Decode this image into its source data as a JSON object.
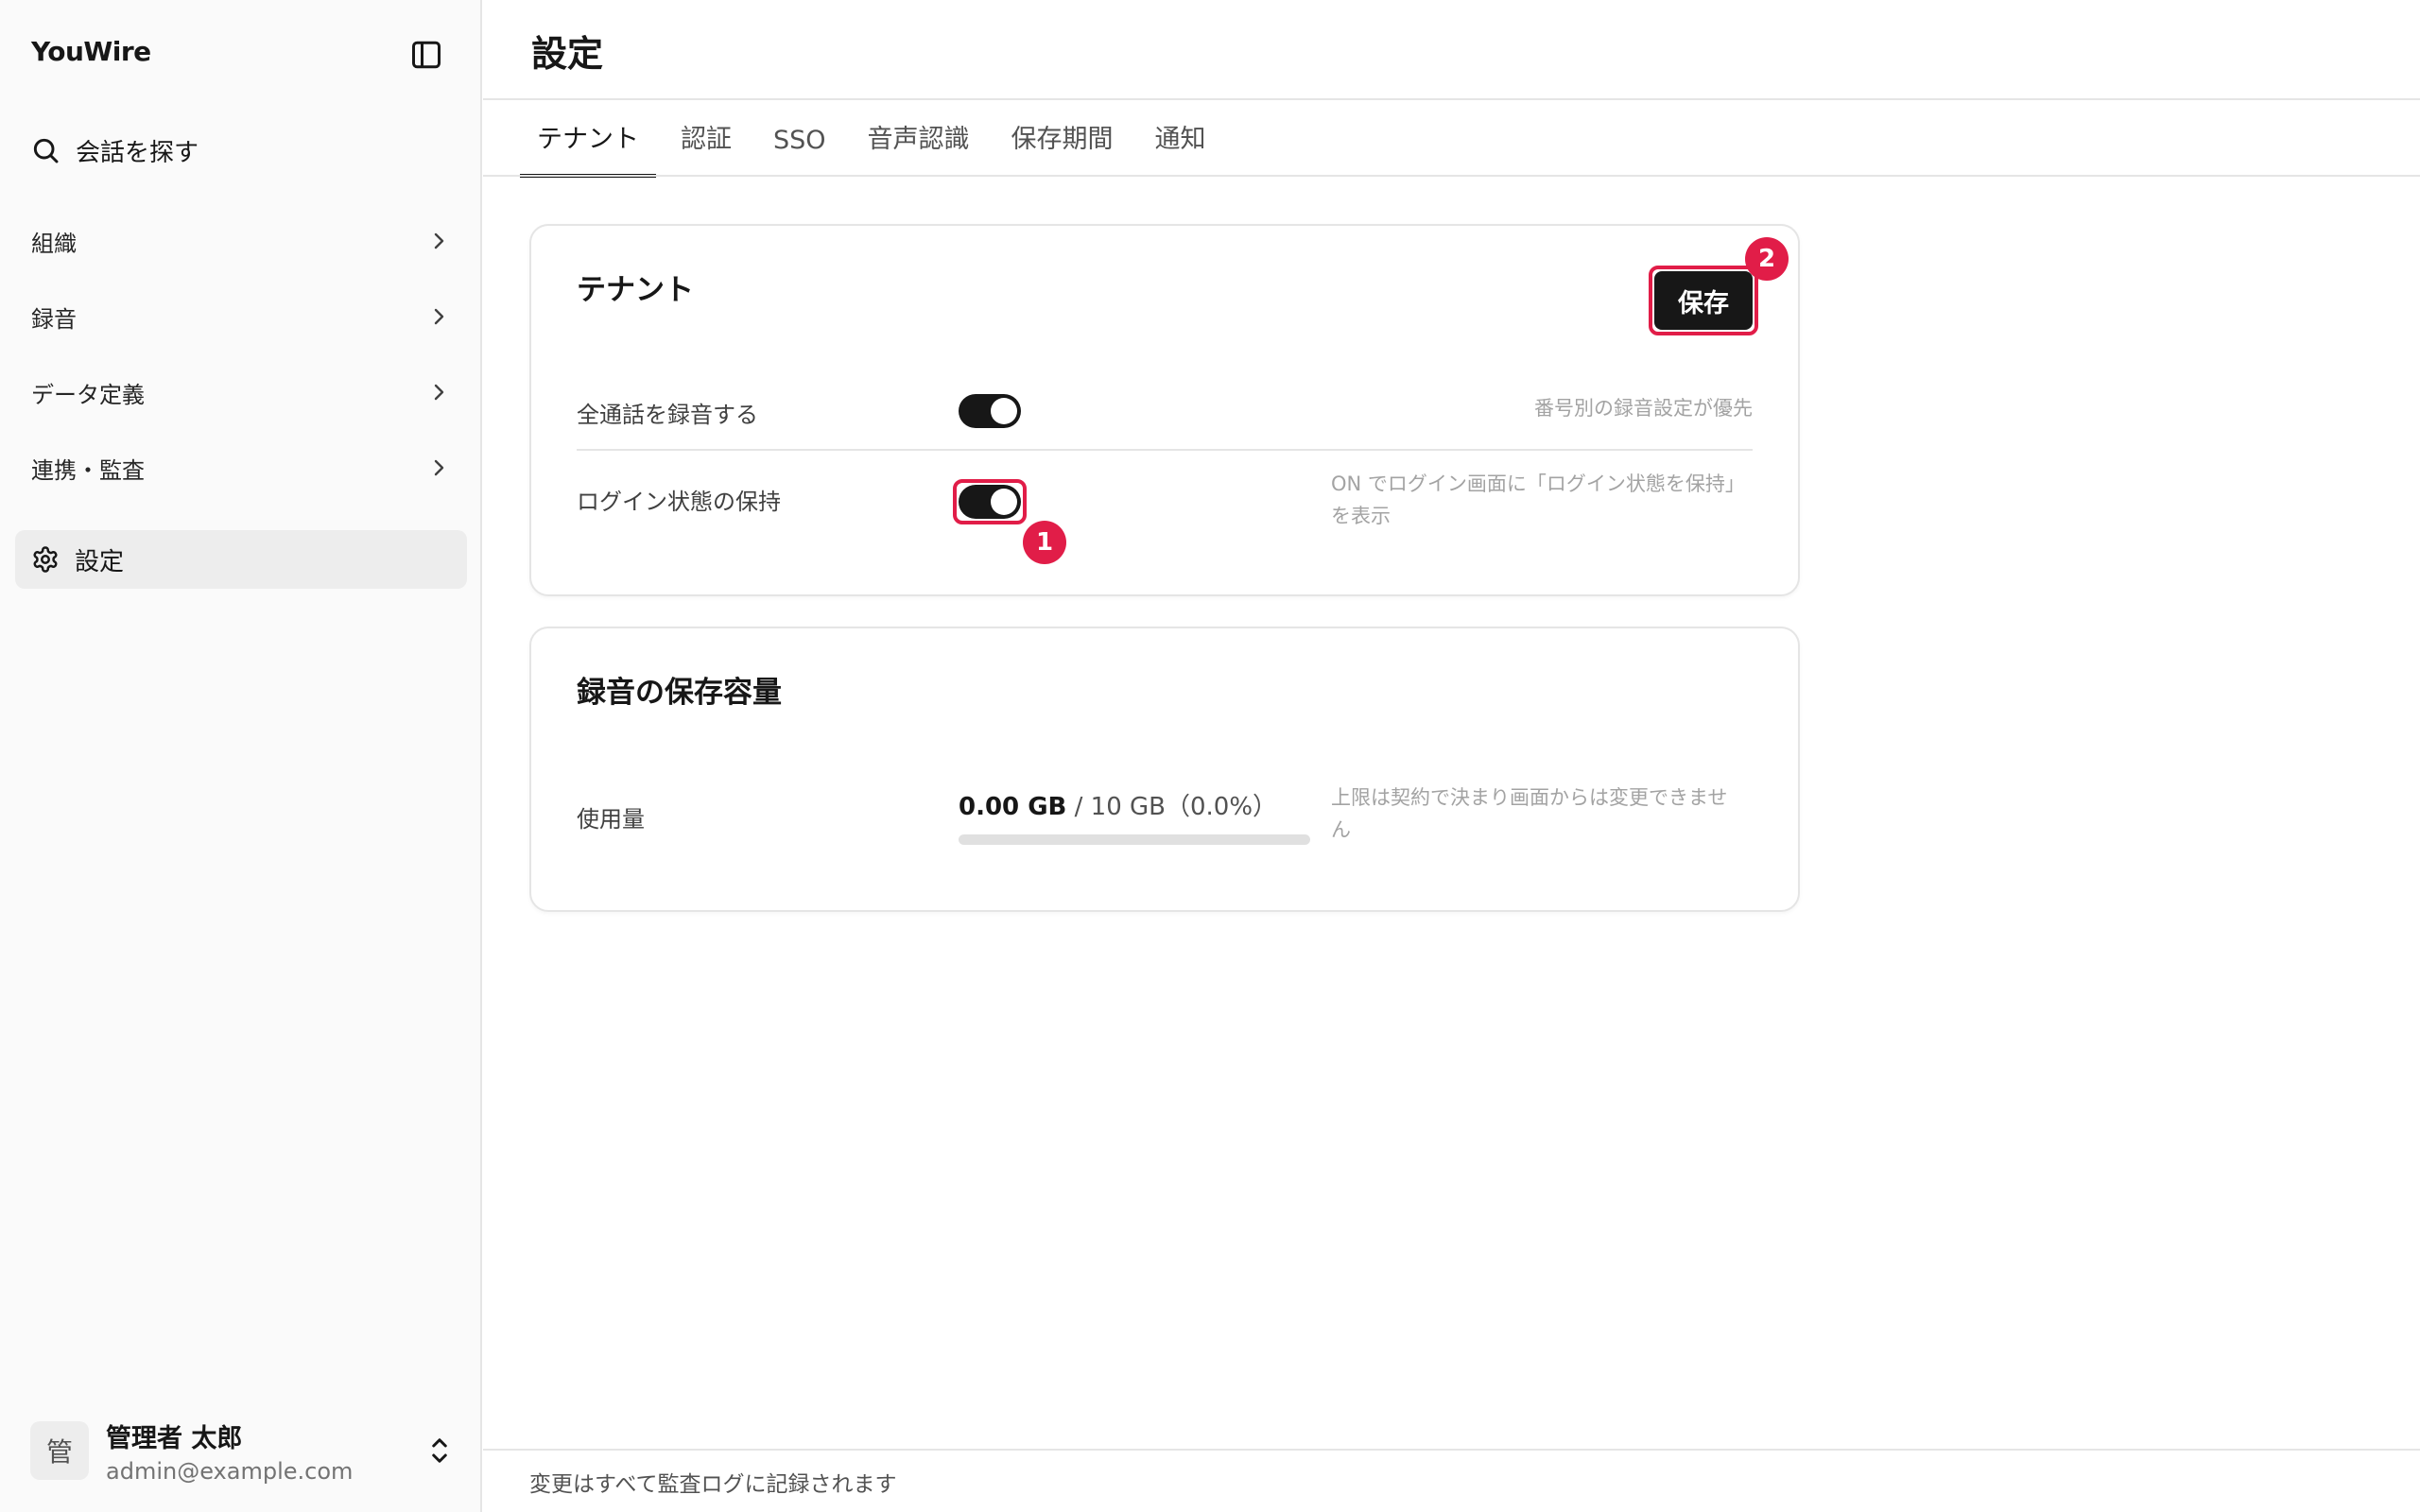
{
  "app": {
    "name": "YouWire"
  },
  "sidebar": {
    "search_label": "会話を探す",
    "groups": [
      {
        "label": "組織"
      },
      {
        "label": "録音"
      },
      {
        "label": "データ定義"
      },
      {
        "label": "連携・監査"
      }
    ],
    "settings_label": "設定",
    "user": {
      "avatar_char": "管",
      "name": "管理者 太郎",
      "email": "admin@example.com"
    }
  },
  "main": {
    "title": "設定",
    "tabs": [
      {
        "label": "テナント",
        "active": true
      },
      {
        "label": "認証"
      },
      {
        "label": "SSO"
      },
      {
        "label": "音声認識"
      },
      {
        "label": "保存期間"
      },
      {
        "label": "通知"
      }
    ],
    "tenant_card": {
      "title": "テナント",
      "save_label": "保存",
      "save_badge": "2",
      "rows": [
        {
          "label": "全通話を録音する",
          "on": true,
          "hint": "番号別の録音設定が優先"
        },
        {
          "label": "ログイン状態の保持",
          "on": true,
          "hint_line1": "ON でログイン画面に「ログイン状態を保持」",
          "hint_line2": "を表示",
          "badge": "1"
        }
      ]
    },
    "storage_card": {
      "title": "録音の保存容量",
      "row_label": "使用量",
      "used": "0.00 GB",
      "rest": " / 10 GB（0.0%）",
      "usage_fraction": 0.0,
      "hint_line1": "上限は契約で決まり画面からは変更できませ",
      "hint_line2": "ん"
    },
    "footer": "変更はすべて監査ログに記録されます"
  },
  "colors": {
    "accent": "#171717",
    "highlight": "#e11d48",
    "muted": "#a3a3a3"
  }
}
